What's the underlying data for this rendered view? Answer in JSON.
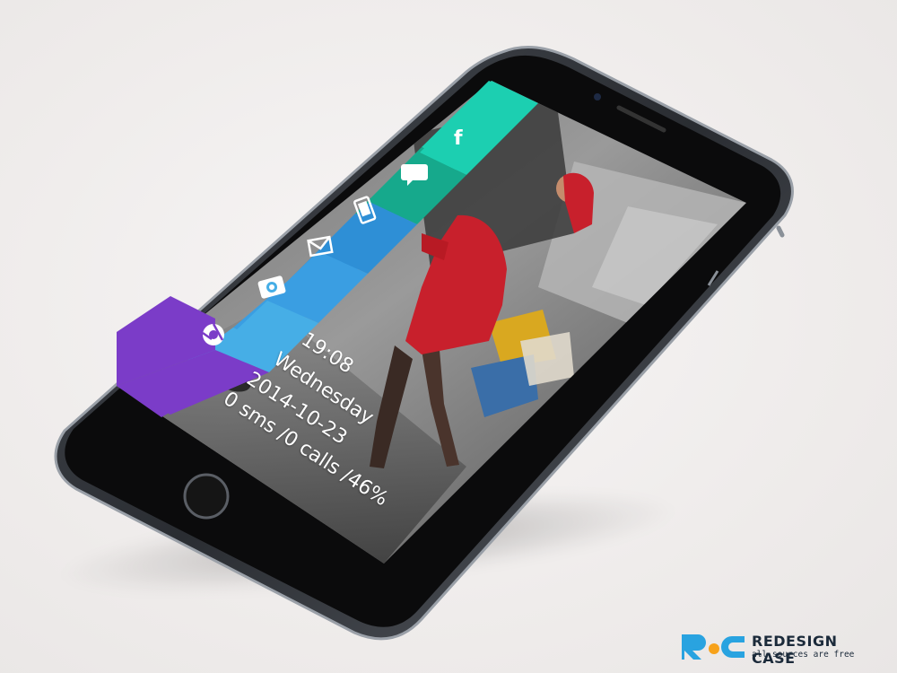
{
  "lockscreen": {
    "time": "19:08",
    "weekday": "Wednesday",
    "date": "2014-10-23",
    "status": "0 sms /0 calls /46%"
  },
  "tiles": [
    {
      "name": "facebook",
      "icon": "facebook-icon",
      "color": "#1ccfb1"
    },
    {
      "name": "messages",
      "icon": "chat-bubble-icon",
      "color": "#16a98c"
    },
    {
      "name": "phone",
      "icon": "phone-icon",
      "color": "#2e8fd6"
    },
    {
      "name": "mail",
      "icon": "mail-icon",
      "color": "#3a9ee2"
    },
    {
      "name": "camera",
      "icon": "camera-icon",
      "color": "#46aee6"
    },
    {
      "name": "chrome",
      "icon": "chrome-icon",
      "color": "#7b3cc8"
    }
  ],
  "brand": {
    "name": "REDESIGN CASE",
    "tagline": "all sources are free",
    "colors": {
      "blue": "#29a3e0",
      "orange": "#f7a21b"
    }
  }
}
